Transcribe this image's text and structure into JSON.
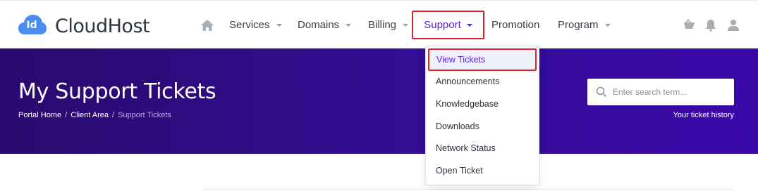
{
  "brand": {
    "logo_badge": "Id",
    "name": "CloudHost"
  },
  "nav": {
    "home_icon": "home-icon",
    "items": [
      {
        "label": "Services",
        "has_caret": true
      },
      {
        "label": "Domains",
        "has_caret": true
      },
      {
        "label": "Billing",
        "has_caret": true
      },
      {
        "label": "Support",
        "has_caret": true,
        "active": true
      },
      {
        "label": "Promotion",
        "has_caret": false
      },
      {
        "label": "Program",
        "has_caret": true
      }
    ]
  },
  "top_icons": [
    "cart-icon",
    "bell-icon",
    "user-icon"
  ],
  "dropdown": {
    "items": [
      {
        "label": "View Tickets",
        "selected": true
      },
      {
        "label": "Announcements"
      },
      {
        "label": "Knowledgebase"
      },
      {
        "label": "Downloads"
      },
      {
        "label": "Network Status"
      },
      {
        "label": "Open Ticket"
      }
    ]
  },
  "hero": {
    "title": "My Support Tickets",
    "breadcrumb": [
      "Portal Home",
      "Client Area",
      "Support Tickets"
    ],
    "search_placeholder": "Enter search term...",
    "subtitle": "Your ticket history"
  },
  "colors": {
    "accent": "#5b22d6",
    "hero_start": "#2a0a6e",
    "hero_end": "#3908a8",
    "logo_blue": "#4a8cf0",
    "highlight_red": "#e0202a"
  }
}
